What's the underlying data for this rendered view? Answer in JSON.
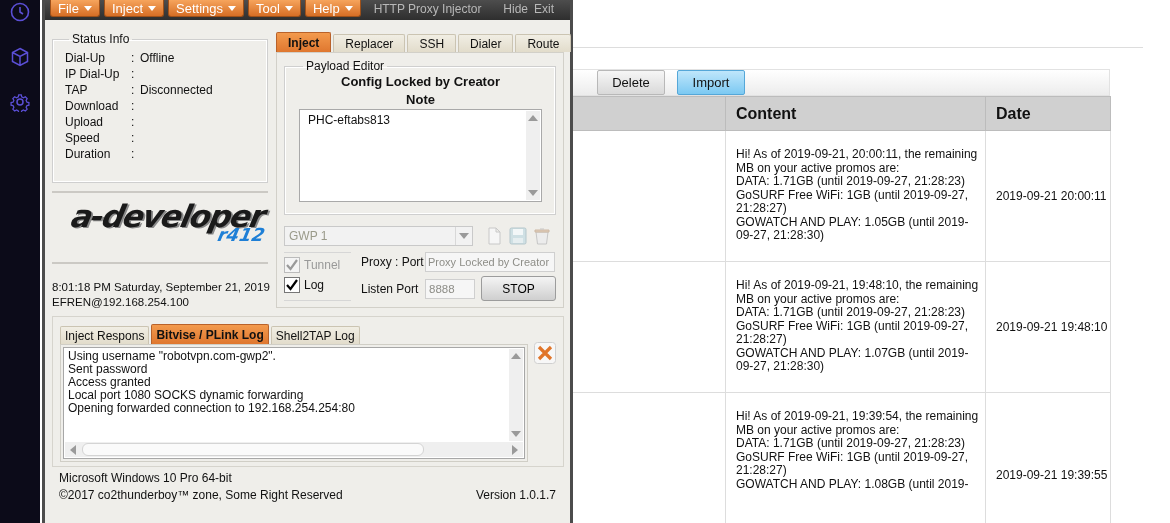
{
  "sidebar": {
    "items": [
      {
        "kind": "clock"
      },
      {
        "kind": "cube"
      },
      {
        "kind": "settings"
      }
    ]
  },
  "toolbar": {
    "buttons": [
      {
        "label": "Delete",
        "highlighted": false
      },
      {
        "label": "Import",
        "highlighted": true
      }
    ]
  },
  "table": {
    "columns": [
      "Content",
      "Date"
    ],
    "rows": [
      {
        "content": [
          "Hi! As of 2019-09-21, 20:00:11, the remaining",
          "MB on your active promos are:",
          "DATA: 1.71GB (until 2019-09-27, 21:28:23)",
          "GoSURF Free WiFi: 1GB (until 2019-09-27,",
          "21:28:27)",
          "GOWATCH AND PLAY: 1.05GB (until 2019-",
          "09-27, 21:28:30)"
        ],
        "date": "2019-09-21 20:00:11"
      },
      {
        "content": [
          "Hi! As of 2019-09-21, 19:48:10, the remaining",
          "MB on your active promos are:",
          "DATA: 1.71GB (until 2019-09-27, 21:28:23)",
          "GoSURF Free WiFi: 1GB (until 2019-09-27,",
          "21:28:27)",
          "GOWATCH AND PLAY: 1.07GB (until 2019-",
          "09-27, 21:28:30)"
        ],
        "date": "2019-09-21 19:48:10"
      },
      {
        "content": [
          "Hi! As of 2019-09-21, 19:39:54, the remaining",
          "MB on your active promos are:",
          "DATA: 1.71GB (until 2019-09-27, 21:28:23)",
          "GoSURF Free WiFi: 1GB (until 2019-09-27,",
          "21:28:27)",
          "GOWATCH AND PLAY: 1.08GB (until 2019-"
        ],
        "date": "2019-09-21 19:39:55"
      }
    ]
  },
  "injector": {
    "menu": [
      "File",
      "Inject",
      "Settings",
      "Tool",
      "Help"
    ],
    "title": "HTTP Proxy Injector",
    "window_buttons": [
      "Hide",
      "Exit"
    ],
    "status_info": {
      "title": "Status Info",
      "rows": [
        {
          "label": "Dial-Up",
          "colon": ":",
          "value": "Offline"
        },
        {
          "label": "IP Dial-Up",
          "colon": ":"
        },
        {
          "label": "TAP",
          "colon": ":",
          "value": "Disconnected"
        },
        {
          "label": "Download",
          "colon": ":"
        },
        {
          "label": "Upload",
          "colon": ":"
        },
        {
          "label": "Speed",
          "colon": ":"
        },
        {
          "label": "Duration",
          "colon": ":"
        }
      ]
    },
    "logo": {
      "text": "a-developer",
      "subtext": "r412"
    },
    "clock": "8:01:18 PM  Saturday, September 21, 2019",
    "user": "EFREN@192.168.254.100",
    "tabs": [
      {
        "label": "Inject",
        "selected": true
      },
      {
        "label": "Replacer",
        "selected": false
      },
      {
        "label": "SSH",
        "selected": false
      },
      {
        "label": "Dialer",
        "selected": false
      },
      {
        "label": "Route",
        "selected": false
      }
    ],
    "payload_editor": {
      "title": "Payload Editor",
      "heading": "Config Locked by Creator",
      "note_title": "Note",
      "note": "PHC-eftabs813"
    },
    "profile": {
      "value": "GWP 1",
      "disabled": true
    },
    "tools": [
      {
        "kind": "new"
      },
      {
        "kind": "save"
      },
      {
        "kind": "delete"
      }
    ],
    "options": [
      {
        "label": "Tunnel",
        "checked": true,
        "disabled": true
      },
      {
        "label": "Log",
        "checked": true,
        "disabled": false
      }
    ],
    "proxy": {
      "label": "Proxy : Port",
      "value": "Proxy Locked by Creator",
      "disabled": true
    },
    "listen": {
      "label": "Listen Port",
      "value": "8888",
      "disabled": true
    },
    "stop_button": "STOP",
    "log_tabs": [
      {
        "label": "Inject Respons",
        "selected": false
      },
      {
        "label": "Bitvise / PLink Log",
        "selected": true
      },
      {
        "label": "Shell2TAP Log",
        "selected": false
      }
    ],
    "log_lines": [
      "Using username \"robotvpn.com-gwp2\".",
      "Sent password",
      "Access granted",
      "Local port 1080 SOCKS dynamic forwarding",
      "Opening forwarded connection to 192.168.254.254:80"
    ],
    "footer": {
      "os": "Microsoft Windows 10 Pro 64-bit",
      "copyright": "©2017 co2thunderboy™ zone, Some Right Reserved",
      "version": "Version 1.0.1.7"
    }
  }
}
